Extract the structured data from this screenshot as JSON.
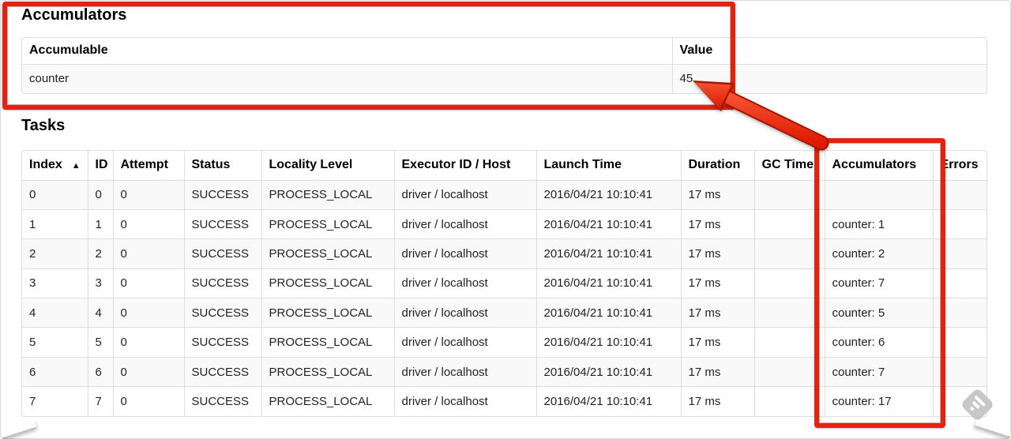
{
  "accumulators_section": {
    "title": "Accumulators",
    "table": {
      "headers": [
        "Accumulable",
        "Value"
      ],
      "rows": [
        [
          "counter",
          "45"
        ]
      ]
    }
  },
  "tasks_section": {
    "title": "Tasks",
    "table": {
      "sort_icon": "▲",
      "headers": [
        "Index",
        "ID",
        "Attempt",
        "Status",
        "Locality Level",
        "Executor ID / Host",
        "Launch Time",
        "Duration",
        "GC Time",
        "Accumulators",
        "Errors"
      ],
      "rows": [
        {
          "index": "0",
          "id": "0",
          "attempt": "0",
          "status": "SUCCESS",
          "locality_level": "PROCESS_LOCAL",
          "executor_id_host": "driver / localhost",
          "launch_time": "2016/04/21 10:10:41",
          "duration": "17 ms",
          "gc_time": "",
          "accumulators": "",
          "errors": ""
        },
        {
          "index": "1",
          "id": "1",
          "attempt": "0",
          "status": "SUCCESS",
          "locality_level": "PROCESS_LOCAL",
          "executor_id_host": "driver / localhost",
          "launch_time": "2016/04/21 10:10:41",
          "duration": "17 ms",
          "gc_time": "",
          "accumulators": "counter: 1",
          "errors": ""
        },
        {
          "index": "2",
          "id": "2",
          "attempt": "0",
          "status": "SUCCESS",
          "locality_level": "PROCESS_LOCAL",
          "executor_id_host": "driver / localhost",
          "launch_time": "2016/04/21 10:10:41",
          "duration": "17 ms",
          "gc_time": "",
          "accumulators": "counter: 2",
          "errors": ""
        },
        {
          "index": "3",
          "id": "3",
          "attempt": "0",
          "status": "SUCCESS",
          "locality_level": "PROCESS_LOCAL",
          "executor_id_host": "driver / localhost",
          "launch_time": "2016/04/21 10:10:41",
          "duration": "17 ms",
          "gc_time": "",
          "accumulators": "counter: 7",
          "errors": ""
        },
        {
          "index": "4",
          "id": "4",
          "attempt": "0",
          "status": "SUCCESS",
          "locality_level": "PROCESS_LOCAL",
          "executor_id_host": "driver / localhost",
          "launch_time": "2016/04/21 10:10:41",
          "duration": "17 ms",
          "gc_time": "",
          "accumulators": "counter: 5",
          "errors": ""
        },
        {
          "index": "5",
          "id": "5",
          "attempt": "0",
          "status": "SUCCESS",
          "locality_level": "PROCESS_LOCAL",
          "executor_id_host": "driver / localhost",
          "launch_time": "2016/04/21 10:10:41",
          "duration": "17 ms",
          "gc_time": "",
          "accumulators": "counter: 6",
          "errors": ""
        },
        {
          "index": "6",
          "id": "6",
          "attempt": "0",
          "status": "SUCCESS",
          "locality_level": "PROCESS_LOCAL",
          "executor_id_host": "driver / localhost",
          "launch_time": "2016/04/21 10:10:41",
          "duration": "17 ms",
          "gc_time": "",
          "accumulators": "counter: 7",
          "errors": ""
        },
        {
          "index": "7",
          "id": "7",
          "attempt": "0",
          "status": "SUCCESS",
          "locality_level": "PROCESS_LOCAL",
          "executor_id_host": "driver / localhost",
          "launch_time": "2016/04/21 10:10:41",
          "duration": "17 ms",
          "gc_time": "",
          "accumulators": "counter: 17",
          "errors": ""
        }
      ]
    }
  },
  "annotations": {
    "highlight_color": "#e32310"
  },
  "watermark": {
    "icon": "feedly-diamond-icon"
  }
}
